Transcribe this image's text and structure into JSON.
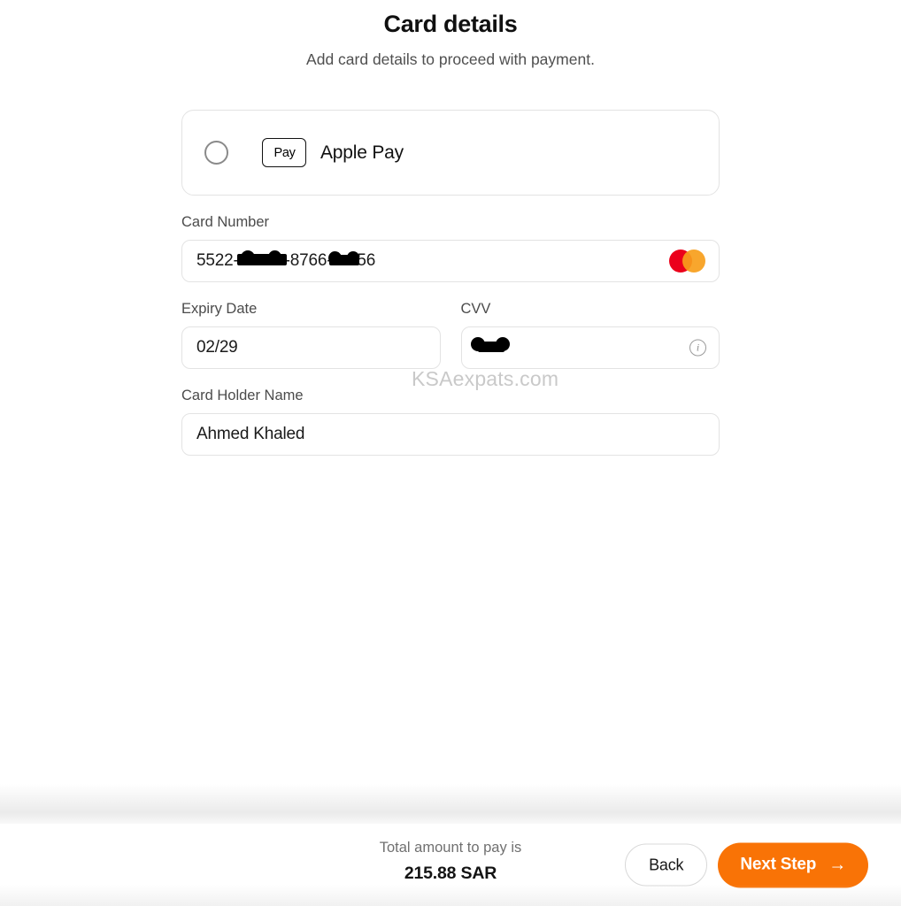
{
  "header": {
    "title": "Card details",
    "subtitle": "Add card details to proceed with payment."
  },
  "wallet": {
    "option_label": "Apple Pay",
    "badge_glyph": "",
    "badge_text": "Pay",
    "selected": false,
    "radio_name": "apple-pay-radio"
  },
  "fields": {
    "card_number": {
      "label": "Card Number",
      "value_prefix": "5522-",
      "value_middle": "-8766-",
      "value_suffix": "56",
      "redacted": true,
      "brand": "mastercard"
    },
    "expiry": {
      "label": "Expiry Date",
      "value": "02/29"
    },
    "cvv": {
      "label": "CVV",
      "value": "",
      "redacted": true,
      "info_icon": "i"
    },
    "holder_name": {
      "label": "Card Holder Name",
      "value": "Ahmed Khaled"
    }
  },
  "watermark": "KSAexpats.com",
  "footer": {
    "total_caption": "Total amount to pay is",
    "total_amount": "215.88 SAR",
    "back_label": "Back",
    "next_label": "Next Step",
    "next_arrow": "→"
  },
  "colors": {
    "accent": "#f97306",
    "mastercard_red": "#eb001b",
    "mastercard_orange": "#f79e1b",
    "border": "#e3e3e3",
    "label_text": "#4b4b4b",
    "watermark": "#c9c9c9"
  }
}
